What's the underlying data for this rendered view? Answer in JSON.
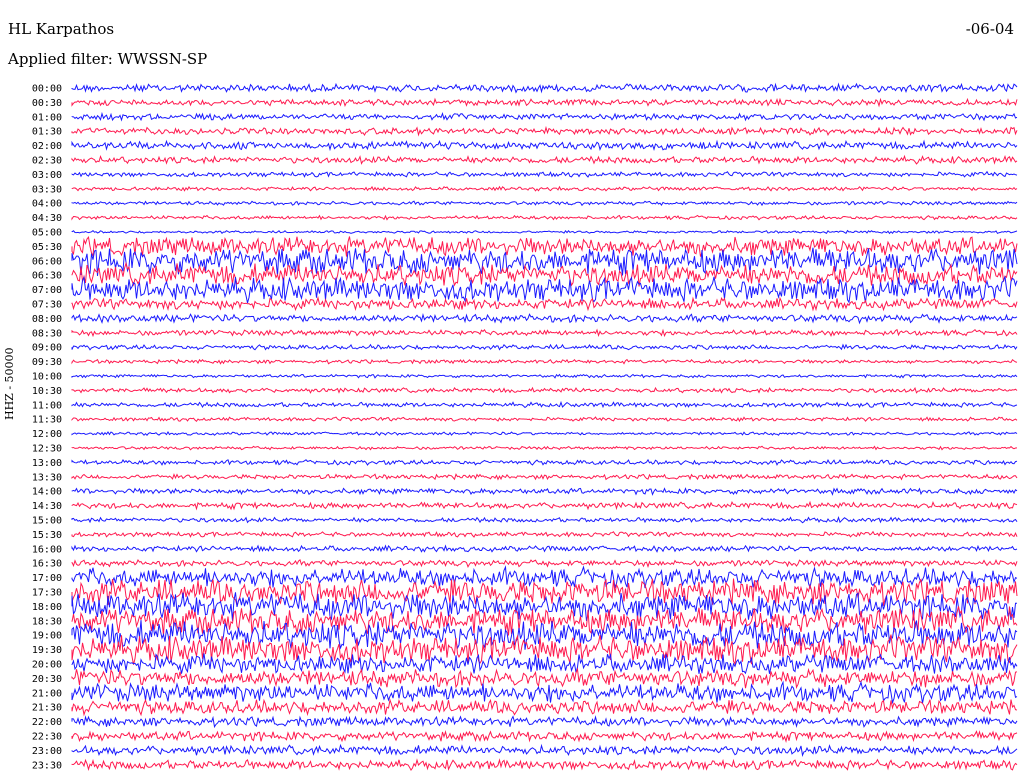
{
  "header": {
    "station": "HL Karpathos",
    "filter": "Applied filter: WWSSN-SP",
    "date": "-06-04"
  },
  "chart_data": {
    "type": "line",
    "title": "HL Karpathos",
    "ylabel": "HHZ - 50000",
    "colors": [
      "#1a1aff",
      "#ff1a4f"
    ],
    "rows": [
      {
        "time": "00:00",
        "amp": 0.25
      },
      {
        "time": "00:30",
        "amp": 0.2
      },
      {
        "time": "01:00",
        "amp": 0.2
      },
      {
        "time": "01:30",
        "amp": 0.22
      },
      {
        "time": "02:00",
        "amp": 0.25
      },
      {
        "time": "02:30",
        "amp": 0.22
      },
      {
        "time": "03:00",
        "amp": 0.15
      },
      {
        "time": "03:30",
        "amp": 0.12
      },
      {
        "time": "04:00",
        "amp": 0.12
      },
      {
        "time": "04:30",
        "amp": 0.12
      },
      {
        "time": "05:00",
        "amp": 0.08
      },
      {
        "time": "05:30",
        "amp": 0.6
      },
      {
        "time": "06:00",
        "amp": 0.85
      },
      {
        "time": "06:30",
        "amp": 0.7
      },
      {
        "time": "07:00",
        "amp": 0.75
      },
      {
        "time": "07:30",
        "amp": 0.35
      },
      {
        "time": "08:00",
        "amp": 0.25
      },
      {
        "time": "08:30",
        "amp": 0.18
      },
      {
        "time": "09:00",
        "amp": 0.15
      },
      {
        "time": "09:30",
        "amp": 0.12
      },
      {
        "time": "10:00",
        "amp": 0.1
      },
      {
        "time": "10:30",
        "amp": 0.15
      },
      {
        "time": "11:00",
        "amp": 0.15
      },
      {
        "time": "11:30",
        "amp": 0.12
      },
      {
        "time": "12:00",
        "amp": 0.1
      },
      {
        "time": "12:30",
        "amp": 0.1
      },
      {
        "time": "13:00",
        "amp": 0.15
      },
      {
        "time": "13:30",
        "amp": 0.15
      },
      {
        "time": "14:00",
        "amp": 0.18
      },
      {
        "time": "14:30",
        "amp": 0.2
      },
      {
        "time": "15:00",
        "amp": 0.15
      },
      {
        "time": "15:30",
        "amp": 0.15
      },
      {
        "time": "16:00",
        "amp": 0.18
      },
      {
        "time": "16:30",
        "amp": 0.2
      },
      {
        "time": "17:00",
        "amp": 0.6
      },
      {
        "time": "17:30",
        "amp": 0.8
      },
      {
        "time": "18:00",
        "amp": 0.85
      },
      {
        "time": "18:30",
        "amp": 0.85
      },
      {
        "time": "19:00",
        "amp": 0.9
      },
      {
        "time": "19:30",
        "amp": 0.85
      },
      {
        "time": "20:00",
        "amp": 0.6
      },
      {
        "time": "20:30",
        "amp": 0.55
      },
      {
        "time": "21:00",
        "amp": 0.6
      },
      {
        "time": "21:30",
        "amp": 0.45
      },
      {
        "time": "22:00",
        "amp": 0.3
      },
      {
        "time": "22:30",
        "amp": 0.3
      },
      {
        "time": "23:00",
        "amp": 0.3
      },
      {
        "time": "23:30",
        "amp": 0.3
      }
    ]
  }
}
